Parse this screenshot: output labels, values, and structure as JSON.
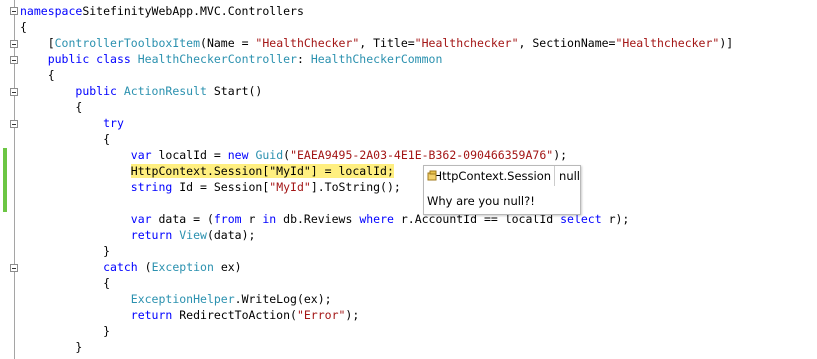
{
  "editor": {
    "lines": [
      [
        [
          "kw",
          "namespace"
        ],
        [
          "",
          "SitefinityWebApp.MVC.Controllers"
        ]
      ],
      [
        [
          "",
          "{"
        ]
      ],
      [
        [
          "",
          "    ["
        ],
        [
          "ty",
          "ControllerToolboxItem"
        ],
        [
          "",
          "(Name = "
        ],
        [
          "st",
          "\"HealthChecker\""
        ],
        [
          "",
          ", Title="
        ],
        [
          "st",
          "\"Healthchecker\""
        ],
        [
          "",
          ", SectionName="
        ],
        [
          "st",
          "\"Healthchecker\""
        ],
        [
          "",
          ")]"
        ]
      ],
      [
        [
          "",
          "    "
        ],
        [
          "kw",
          "public class"
        ],
        [
          "",
          ""
        ],
        [
          "ty",
          " HealthCheckerController"
        ],
        [
          "",
          ": "
        ],
        [
          "ty",
          "HealthCheckerCommon"
        ]
      ],
      [
        [
          "",
          "    {"
        ]
      ],
      [
        [
          "",
          "        "
        ],
        [
          "kw",
          "public"
        ],
        [
          "",
          ""
        ],
        [
          "ty",
          " ActionResult"
        ],
        [
          "",
          " Start()"
        ]
      ],
      [
        [
          "",
          "        {"
        ]
      ],
      [
        [
          "",
          "            "
        ],
        [
          "kw",
          "try"
        ]
      ],
      [
        [
          "",
          "            {"
        ]
      ],
      [
        [
          "",
          "                "
        ],
        [
          "kw",
          "var"
        ],
        [
          "",
          " localId = "
        ],
        [
          "kw",
          "new"
        ],
        [
          "ty",
          " Guid"
        ],
        [
          "",
          "("
        ],
        [
          "st",
          "\"EAEA9495-2A03-4E1E-B362-090466359A76\""
        ],
        [
          "",
          ");"
        ]
      ],
      [
        [
          "",
          "                "
        ],
        [
          "hl",
          "HttpContext.Session[\"MyId\"] = localId;"
        ]
      ],
      [
        [
          "",
          "                "
        ],
        [
          "kw",
          "string"
        ],
        [
          "",
          " Id = Session["
        ],
        [
          "st",
          "\"MyId\""
        ],
        [
          "",
          "].ToString();"
        ]
      ],
      [
        [
          "",
          ""
        ]
      ],
      [
        [
          "",
          "                "
        ],
        [
          "kw",
          "var"
        ],
        [
          "",
          " data = ("
        ],
        [
          "kw",
          "from"
        ],
        [
          "",
          " r "
        ],
        [
          "kw",
          "in"
        ],
        [
          "",
          " db.Reviews "
        ],
        [
          "kw",
          "where"
        ],
        [
          "",
          " r.AccountId == localId "
        ],
        [
          "kw",
          "select"
        ],
        [
          "",
          " r);"
        ]
      ],
      [
        [
          "",
          "                "
        ],
        [
          "kw",
          "return"
        ],
        [
          "ty",
          " View"
        ],
        [
          "",
          "(data);"
        ]
      ],
      [
        [
          "",
          "            }"
        ]
      ],
      [
        [
          "",
          "            "
        ],
        [
          "kw",
          "catch"
        ],
        [
          "",
          " ("
        ],
        [
          "ty",
          "Exception"
        ],
        [
          "",
          " ex)"
        ]
      ],
      [
        [
          "",
          "            {"
        ]
      ],
      [
        [
          "",
          "                "
        ],
        [
          "ty",
          "ExceptionHelper"
        ],
        [
          "",
          ".WriteLog(ex);"
        ]
      ],
      [
        [
          "",
          "                "
        ],
        [
          "kw",
          "return"
        ],
        [
          "",
          " RedirectToAction("
        ],
        [
          "st",
          "\"Error\""
        ],
        [
          "",
          ");"
        ]
      ],
      [
        [
          "",
          "            }"
        ]
      ],
      [
        [
          "",
          "        }"
        ]
      ]
    ]
  },
  "tooltip": {
    "name": "HttpContext.Session",
    "value": "null",
    "comment": "Why are you null?!",
    "icon": "pin-icon"
  },
  "colors": {
    "keyword": "#0000ff",
    "type": "#2b91af",
    "string": "#a31515",
    "highlight": "#ffef80",
    "change_bar": "#6cc644"
  }
}
